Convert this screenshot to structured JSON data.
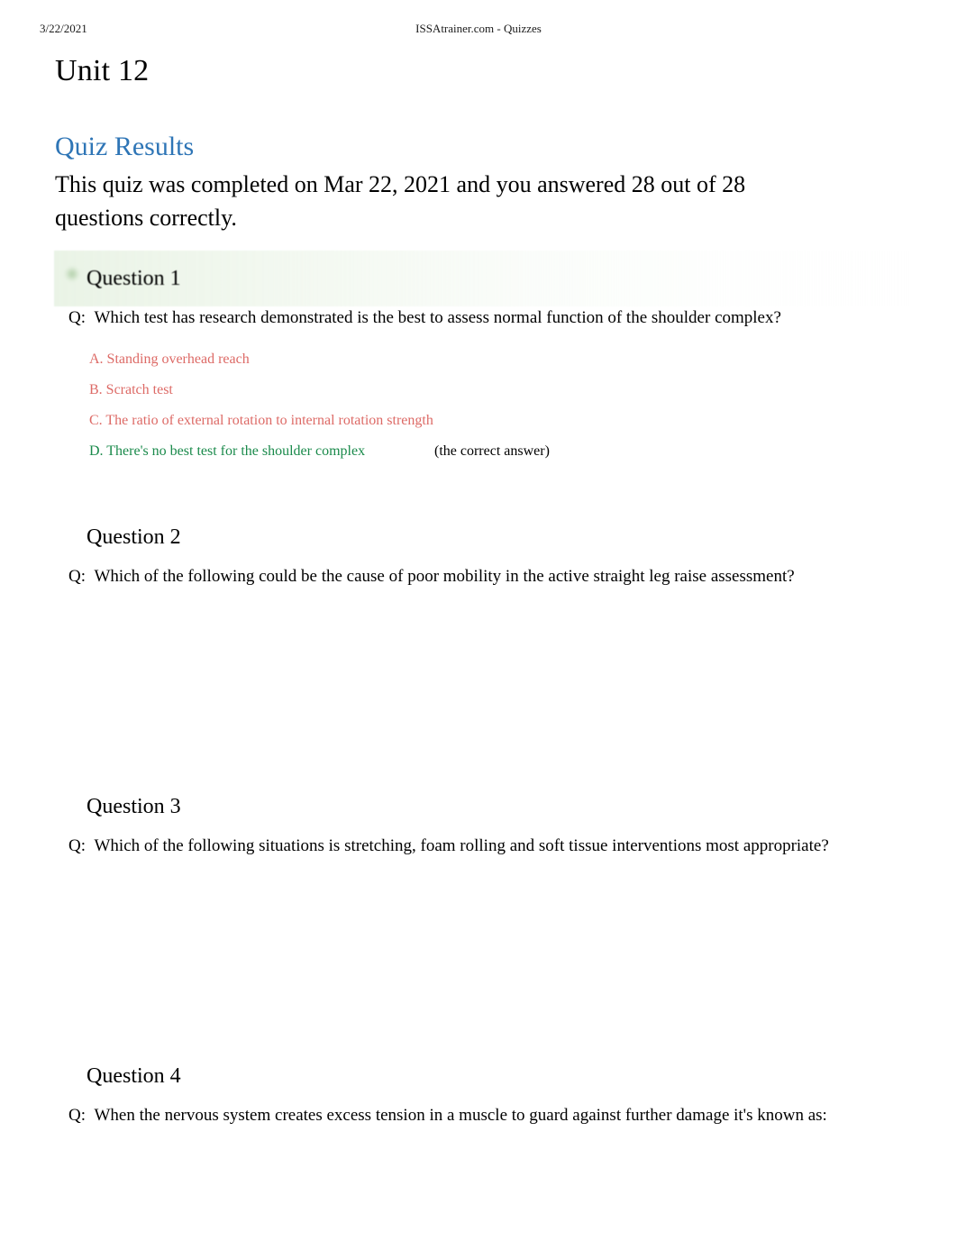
{
  "header": {
    "date": "3/22/2021",
    "site_title": "ISSAtrainer.com - Quizzes"
  },
  "document": {
    "title": "Unit 12"
  },
  "results": {
    "heading": "Quiz Results",
    "summary": "This quiz was completed on Mar 22, 2021 and you answered 28 out of 28 questions correctly.",
    "completed_date": "Mar 22, 2021",
    "correct_count": "28",
    "total_count": "28"
  },
  "colors": {
    "heading_blue": "#2e75b6",
    "incorrect_red": "#dd6a66",
    "correct_green": "#1a8a4b",
    "band_green": "#e9f3e5"
  },
  "questions": [
    {
      "title": "Question 1",
      "q_prefix": "Q:",
      "text": "Which test has research demonstrated is the best to assess normal function of the shoulder complex?",
      "highlighted": true,
      "marker": "green-dot-icon",
      "answers": [
        {
          "label": "A. Standing overhead reach",
          "correct": false,
          "note": ""
        },
        {
          "label": "B. Scratch test",
          "correct": false,
          "note": ""
        },
        {
          "label": "C. The ratio of external rotation to internal rotation strength",
          "correct": false,
          "note": ""
        },
        {
          "label": "D. There's no best test for the shoulder complex",
          "correct": true,
          "note": "(the correct answer)"
        }
      ]
    },
    {
      "title": "Question 2",
      "q_prefix": "Q:",
      "text": "Which of the following could be the cause of poor mobility in the active straight leg raise assessment?",
      "highlighted": false,
      "marker": "",
      "answers": []
    },
    {
      "title": "Question 3",
      "q_prefix": "Q:",
      "text": "Which of the following situations is stretching, foam rolling and soft tissue interventions most appropriate?",
      "highlighted": false,
      "marker": "",
      "answers": []
    },
    {
      "title": "Question 4",
      "q_prefix": "Q:",
      "text": "When the nervous system creates excess tension in a muscle to guard against further damage it's known as:",
      "highlighted": false,
      "marker": "",
      "answers": []
    }
  ]
}
